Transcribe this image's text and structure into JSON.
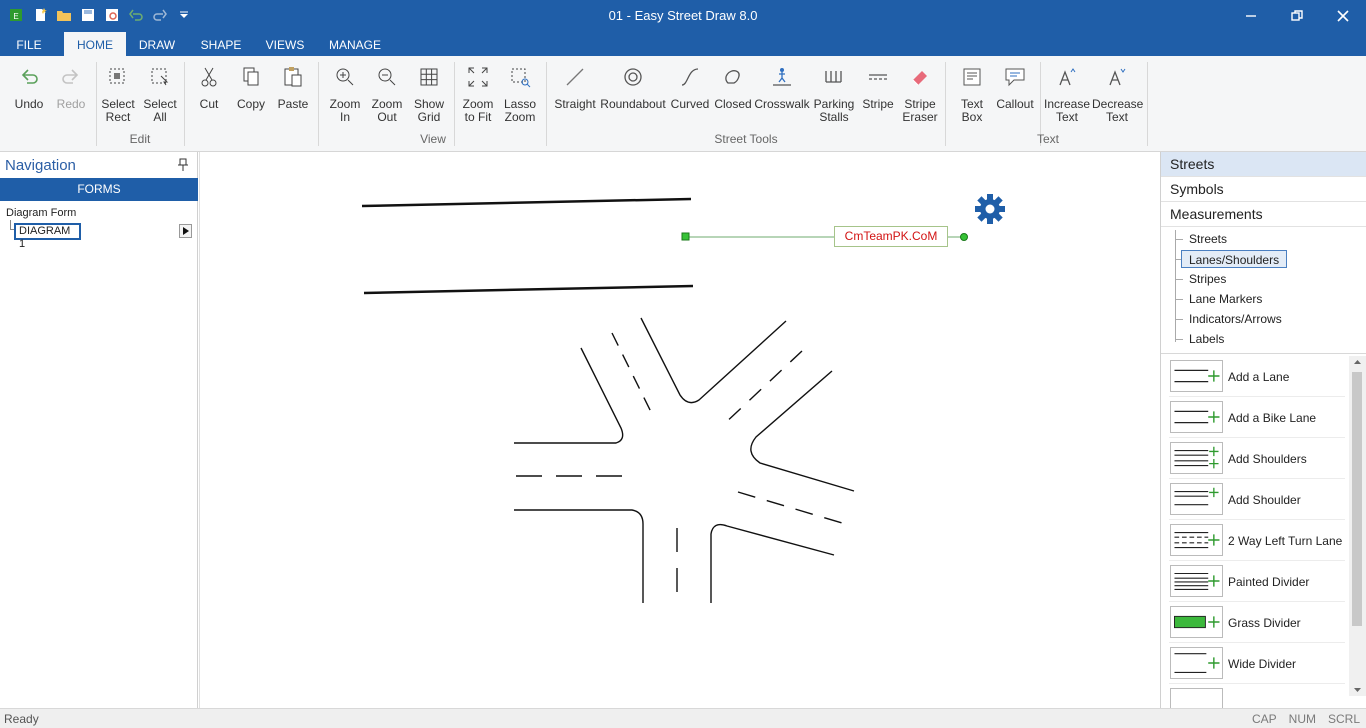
{
  "window": {
    "title": "01 - Easy Street Draw 8.0",
    "minimize_icon": "minimize-icon",
    "restore_icon": "restore-icon",
    "close_icon": "close-icon"
  },
  "tabs": [
    {
      "label": "FILE"
    },
    {
      "label": "HOME"
    },
    {
      "label": "DRAW"
    },
    {
      "label": "SHAPE"
    },
    {
      "label": "VIEWS"
    },
    {
      "label": "MANAGE"
    }
  ],
  "ribbon": {
    "undo": "Undo",
    "redo": "Redo",
    "select_rect": "Select\nRect",
    "select_all": "Select\nAll",
    "cut": "Cut",
    "copy": "Copy",
    "paste": "Paste",
    "zoom_in": "Zoom\nIn",
    "zoom_out": "Zoom\nOut",
    "show_grid": "Show\nGrid",
    "zoom_to_fit": "Zoom\nto Fit",
    "lasso_zoom": "Lasso\nZoom",
    "straight": "Straight",
    "roundabout": "Roundabout",
    "curved": "Curved",
    "closed": "Closed",
    "crosswalk": "Crosswalk",
    "parking_stalls": "Parking\nStalls",
    "stripe": "Stripe",
    "stripe_eraser": "Stripe\nEraser",
    "text_box": "Text\nBox",
    "callout": "Callout",
    "increase_text": "Increase\nText",
    "decrease_text": "Decrease\nText",
    "groups": {
      "edit": "Edit",
      "view": "View",
      "street_tools": "Street Tools",
      "text": "Text"
    }
  },
  "navigation": {
    "title": "Navigation",
    "forms_label": "FORMS",
    "diagram_form_label": "Diagram Form",
    "diagram_item": "DIAGRAM 1"
  },
  "canvas": {
    "watermark": "CmTeamPK.CoM"
  },
  "right_panel": {
    "categories": [
      "Streets",
      "Symbols",
      "Measurements"
    ],
    "subcategories": [
      "Streets",
      "Lanes/Shoulders",
      "Stripes",
      "Lane Markers",
      "Indicators/Arrows",
      "Labels"
    ],
    "selected_subcategory": "Lanes/Shoulders",
    "tools": [
      {
        "label": "Add a Lane"
      },
      {
        "label": "Add a Bike Lane"
      },
      {
        "label": "Add Shoulders"
      },
      {
        "label": "Add Shoulder"
      },
      {
        "label": "2 Way Left Turn Lane"
      },
      {
        "label": "Painted Divider"
      },
      {
        "label": "Grass Divider"
      },
      {
        "label": "Wide Divider"
      }
    ]
  },
  "status": {
    "left": "Ready",
    "cap": "CAP",
    "num": "NUM",
    "scrl": "SCRL"
  },
  "colors": {
    "accent": "#1f5ea8",
    "watermark_text": "#d21313",
    "gear": "#1f5ea8",
    "grass": "#3cb83c",
    "plus": "#2e9a2e"
  }
}
